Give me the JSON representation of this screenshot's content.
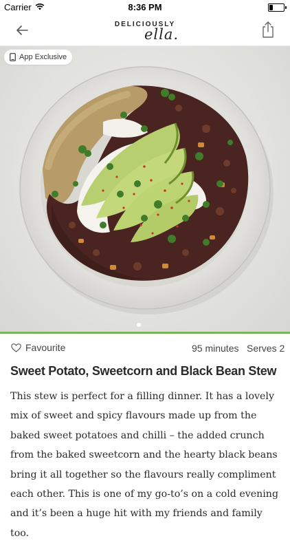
{
  "status_bar": {
    "carrier": "Carrier",
    "time": "8:36 PM",
    "battery_level": 0.3
  },
  "nav": {
    "brand_top": "DELICIOUSLY",
    "brand_script": "ella.",
    "back_icon": "arrow-left-icon",
    "share_icon": "share-icon"
  },
  "hero": {
    "badge_label": "App Exclusive",
    "badge_icon": "phone-icon",
    "page_count": 1,
    "current_page": 1
  },
  "recipe": {
    "favourite_label": "Favourite",
    "time": "95 minutes",
    "serves": "Serves 2",
    "title": "Sweet Potato, Sweetcorn and Black Bean Stew",
    "description": "This stew is perfect for a filling dinner. It has a lovely mix of sweet and spicy flavours made up from the baked sweet potatoes and chilli – the added crunch from the baked sweetcorn and the hearty black beans bring it all together so the flavours really compliment each other. This is one of my go-to’s on a cold evening and it’s been a huge hit with my friends and family too."
  },
  "colors": {
    "accent": "#7bb35c"
  }
}
